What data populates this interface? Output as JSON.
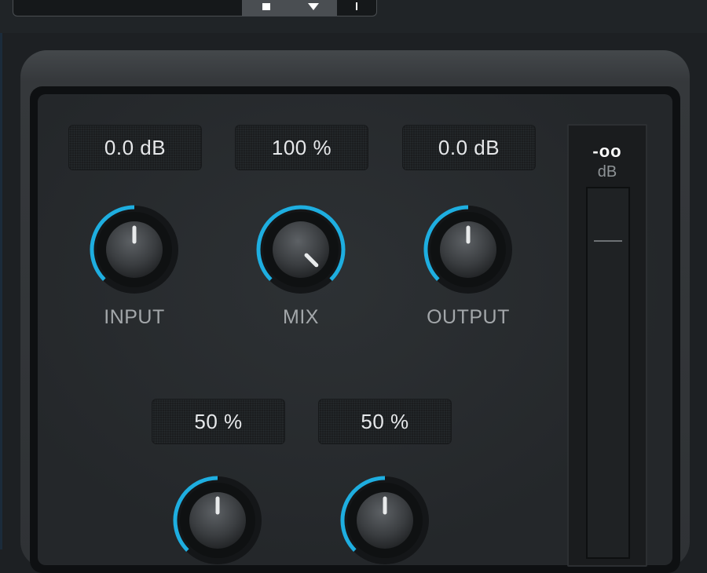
{
  "toolbar": {
    "buttons": [
      {
        "name": "store-icon"
      },
      {
        "name": "load-icon"
      },
      {
        "name": "plus-icon"
      }
    ]
  },
  "controls": [
    {
      "id": "input",
      "value": "0.0 dB",
      "label": "INPUT",
      "fraction": 0.5
    },
    {
      "id": "mix",
      "value": "100 %",
      "label": "MIX",
      "fraction": 1.0
    },
    {
      "id": "output",
      "value": "0.0 dB",
      "label": "OUTPUT",
      "fraction": 0.5
    },
    {
      "id": "knob4",
      "value": "50 %",
      "label": "",
      "fraction": 0.5
    },
    {
      "id": "knob5",
      "value": "50 %",
      "label": "",
      "fraction": 0.5
    }
  ],
  "meter": {
    "peak": "-oo",
    "unit": "dB"
  },
  "colors": {
    "accent": "#1eaee0",
    "panel": "#2a2d30"
  }
}
